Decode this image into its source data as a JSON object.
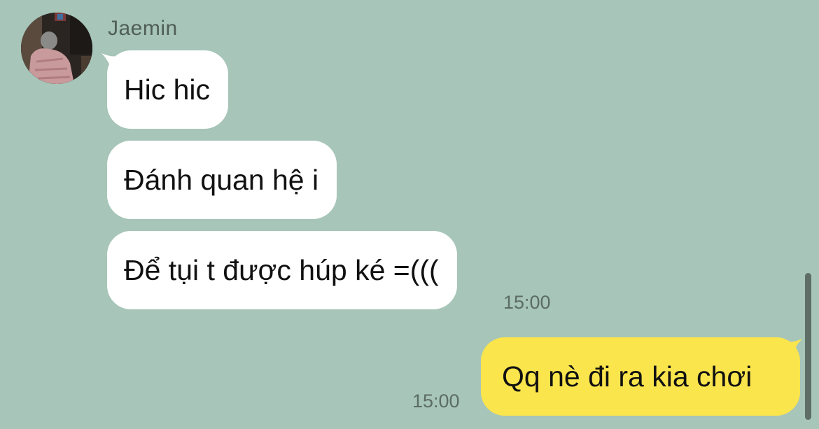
{
  "chat": {
    "sender": {
      "name": "Jaemin"
    },
    "incoming_messages": [
      {
        "text": "Hic hic"
      },
      {
        "text": "Đánh quan hệ i"
      },
      {
        "text": "Để tụi t được húp ké =((("
      }
    ],
    "incoming_time": "15:00",
    "outgoing_messages": [
      {
        "text": "Qq nè đi ra kia chơi"
      }
    ],
    "outgoing_time": "15:00"
  },
  "colors": {
    "background": "#a7c5b8",
    "incoming_bubble": "#ffffff",
    "outgoing_bubble": "#fbe54d"
  }
}
